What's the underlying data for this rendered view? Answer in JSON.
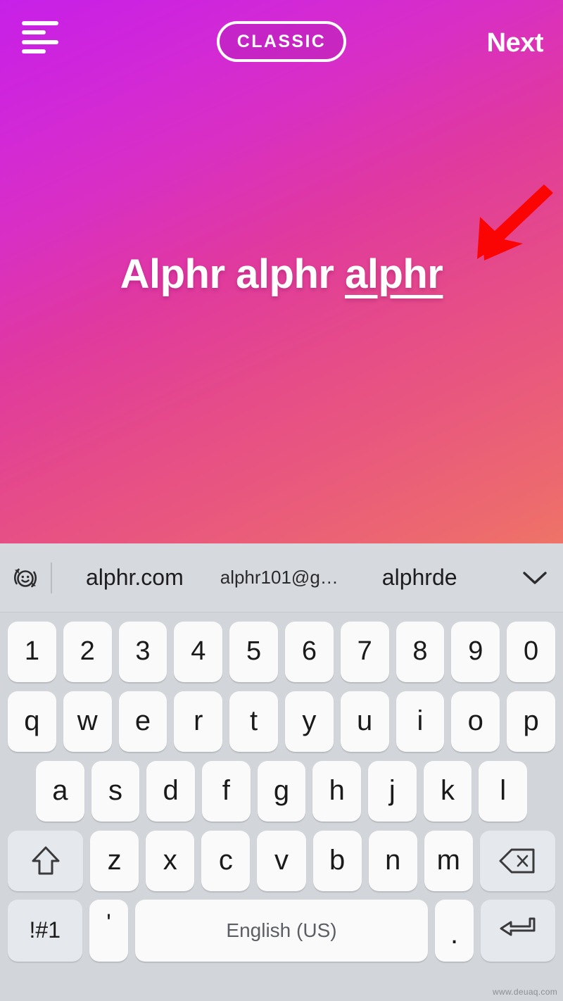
{
  "colors": {
    "gradient_top_left": "#c721e8",
    "gradient_bottom_right": "#ef7467",
    "arrow_red": "#fb0404",
    "keyboard_bg": "#d2d5da",
    "key_light": "#fafafa",
    "key_dark": "#e5e8ec",
    "suggestion_bar_bg": "#d6d9dd"
  },
  "topbar": {
    "menu_icon": "text-align-menu-icon",
    "mode_label": "CLASSIC",
    "next_label": "Next"
  },
  "story": {
    "text_parts": [
      {
        "text": "Alphr alphr ",
        "underlined": false
      },
      {
        "text": "alphr",
        "underlined": true
      }
    ],
    "full_text": "Alphr alphr alphr",
    "annotation_arrow": "red-arrow-pointing-down-left"
  },
  "keyboard": {
    "suggestion_bar": {
      "emoji_icon": "emoji-switch-icon",
      "suggestions": [
        "alphr.com",
        "alphr101@g…",
        "alphrde"
      ],
      "expand_icon": "chevron-down-icon"
    },
    "rows": [
      {
        "name": "number-row",
        "keys": [
          {
            "label": "1",
            "name": "key-1",
            "style": "num"
          },
          {
            "label": "2",
            "name": "key-2",
            "style": "num"
          },
          {
            "label": "3",
            "name": "key-3",
            "style": "num"
          },
          {
            "label": "4",
            "name": "key-4",
            "style": "num"
          },
          {
            "label": "5",
            "name": "key-5",
            "style": "num"
          },
          {
            "label": "6",
            "name": "key-6",
            "style": "num"
          },
          {
            "label": "7",
            "name": "key-7",
            "style": "num"
          },
          {
            "label": "8",
            "name": "key-8",
            "style": "num"
          },
          {
            "label": "9",
            "name": "key-9",
            "style": "num"
          },
          {
            "label": "0",
            "name": "key-0",
            "style": "num"
          }
        ]
      },
      {
        "name": "qwerty-row",
        "keys": [
          {
            "label": "q",
            "name": "key-q"
          },
          {
            "label": "w",
            "name": "key-w"
          },
          {
            "label": "e",
            "name": "key-e"
          },
          {
            "label": "r",
            "name": "key-r"
          },
          {
            "label": "t",
            "name": "key-t"
          },
          {
            "label": "y",
            "name": "key-y"
          },
          {
            "label": "u",
            "name": "key-u"
          },
          {
            "label": "i",
            "name": "key-i"
          },
          {
            "label": "o",
            "name": "key-o"
          },
          {
            "label": "p",
            "name": "key-p"
          }
        ]
      },
      {
        "name": "asdf-row",
        "keys": [
          {
            "label": "a",
            "name": "key-a"
          },
          {
            "label": "s",
            "name": "key-s"
          },
          {
            "label": "d",
            "name": "key-d"
          },
          {
            "label": "f",
            "name": "key-f"
          },
          {
            "label": "g",
            "name": "key-g"
          },
          {
            "label": "h",
            "name": "key-h"
          },
          {
            "label": "j",
            "name": "key-j"
          },
          {
            "label": "k",
            "name": "key-k"
          },
          {
            "label": "l",
            "name": "key-l"
          }
        ]
      },
      {
        "name": "zxcv-row",
        "keys": [
          {
            "label": "",
            "name": "key-shift",
            "icon": "shift-arrow-up-icon"
          },
          {
            "label": "z",
            "name": "key-z"
          },
          {
            "label": "x",
            "name": "key-x"
          },
          {
            "label": "c",
            "name": "key-c"
          },
          {
            "label": "v",
            "name": "key-v"
          },
          {
            "label": "b",
            "name": "key-b"
          },
          {
            "label": "n",
            "name": "key-n"
          },
          {
            "label": "m",
            "name": "key-m"
          },
          {
            "label": "",
            "name": "key-backspace",
            "icon": "backspace-delete-icon"
          }
        ]
      },
      {
        "name": "bottom-row",
        "keys": [
          {
            "label": "!#1",
            "name": "key-symbols"
          },
          {
            "label": "'",
            "name": "key-apostrophe"
          },
          {
            "label": "English (US)",
            "name": "key-space"
          },
          {
            "label": ".",
            "name": "key-period"
          },
          {
            "label": "",
            "name": "key-enter",
            "icon": "enter-return-icon"
          }
        ]
      }
    ]
  },
  "watermark": {
    "text": "www.deuaq.com"
  }
}
